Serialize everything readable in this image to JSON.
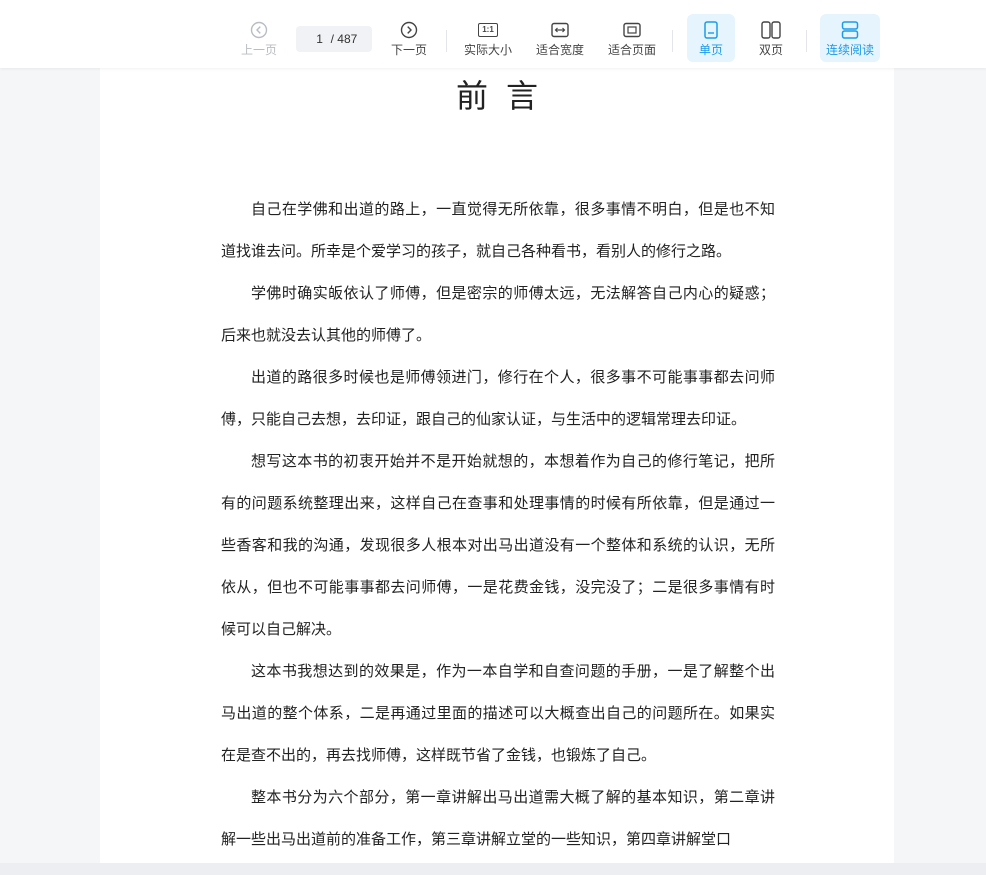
{
  "toolbar": {
    "prev_label": "上一页",
    "current_page": "1",
    "total_pages": "/ 487",
    "next_label": "下一页",
    "actual_size_label": "实际大小",
    "fit_width_label": "适合宽度",
    "fit_page_label": "适合页面",
    "single_page_label": "单页",
    "double_page_label": "双页",
    "continuous_label": "连续阅读",
    "actual_size_icon_text": "1:1"
  },
  "document": {
    "title": "前言",
    "paragraphs": [
      "自己在学佛和出道的路上，一直觉得无所依靠，很多事情不明白，但是也不知道找谁去问。所幸是个爱学习的孩子，就自己各种看书，看别人的修行之路。",
      "学佛时确实皈依认了师傅，但是密宗的师傅太远，无法解答自己内心的疑惑；后来也就没去认其他的师傅了。",
      "出道的路很多时候也是师傅领进门，修行在个人，很多事不可能事事都去问师傅，只能自己去想，去印证，跟自己的仙家认证，与生活中的逻辑常理去印证。",
      "想写这本书的初衷开始并不是开始就想的，本想着作为自己的修行笔记，把所有的问题系统整理出来，这样自己在查事和处理事情的时候有所依靠，但是通过一些香客和我的沟通，发现很多人根本对出马出道没有一个整体和系统的认识，无所依从，但也不可能事事都去问师傅，一是花费金钱，没完没了；二是很多事情有时候可以自己解决。",
      "这本书我想达到的效果是，作为一本自学和自查问题的手册，一是了解整个出马出道的整个体系，二是再通过里面的描述可以大概查出自己的问题所在。如果实在是查不出的，再去找师傅，这样既节省了金钱，也锻炼了自己。",
      "整本书分为六个部分，第一章讲解出马出道需大概了解的基本知识，第二章讲解一些出马出道前的准备工作，第三章讲解立堂的一些知识，第四章讲解堂口"
    ]
  },
  "colors": {
    "accent": "#1c9be8",
    "active_bg": "#e6f4fd",
    "disabled": "#b9bcc2"
  }
}
